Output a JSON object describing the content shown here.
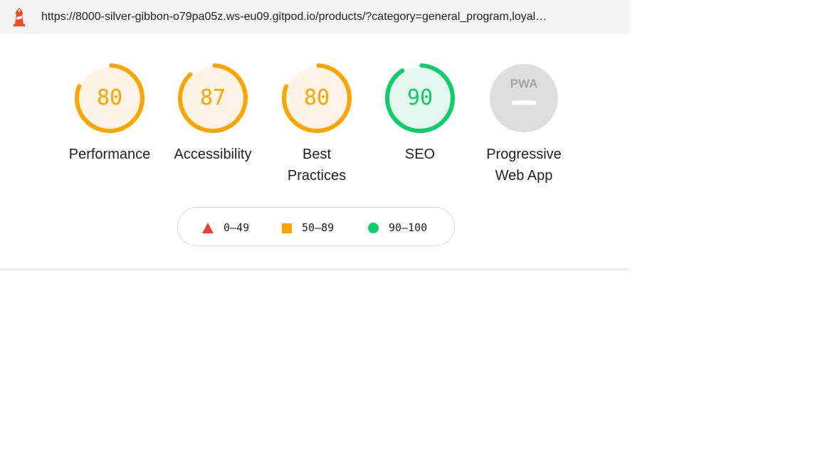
{
  "address_bar": {
    "url": "https://8000-silver-gibbon-o79pa05z.ws-eu09.gitpod.io/products/?category=general_program,loyal…",
    "logo_icon": "lighthouse-icon"
  },
  "gauges": [
    {
      "score": "80",
      "score_fraction": 0.8,
      "label": "Performance",
      "status": "average"
    },
    {
      "score": "87",
      "score_fraction": 0.87,
      "label": "Accessibility",
      "status": "average"
    },
    {
      "score": "80",
      "score_fraction": 0.8,
      "label": "Best Practices",
      "label_lines": [
        "Best",
        "Practices"
      ],
      "status": "average"
    },
    {
      "score": "90",
      "score_fraction": 0.9,
      "label": "SEO",
      "status": "pass"
    }
  ],
  "pwa": {
    "label_lines": [
      "Progressive",
      "Web App"
    ],
    "badge_text": "PWA",
    "icon": "pwa-badge-icon"
  },
  "legend": [
    {
      "range": "0–49",
      "icon": "triangle-icon",
      "color": "#eb4132"
    },
    {
      "range": "50–89",
      "icon": "square-icon",
      "color": "#ffa400"
    },
    {
      "range": "90–100",
      "icon": "circle-icon",
      "color": "#0cce6b"
    }
  ],
  "colors": {
    "average": "#ffa400",
    "average_bg": "#fff4e5",
    "pass": "#0cce6b",
    "pass_bg": "#e6f9ef",
    "fail": "#eb4132",
    "pwa_bg": "#dedede"
  }
}
